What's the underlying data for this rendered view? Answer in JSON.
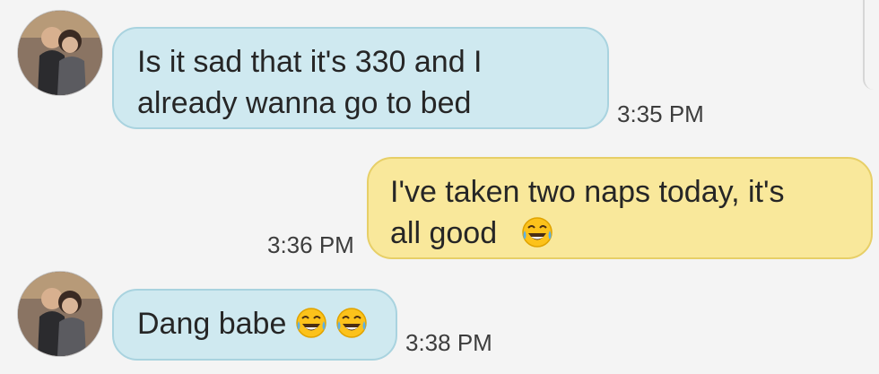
{
  "conversation": {
    "messages": [
      {
        "direction": "incoming",
        "text": "Is it sad that it's 330 and I\nalready wanna go to bed",
        "time": "3:35 PM",
        "emojis": []
      },
      {
        "direction": "outgoing",
        "text": "I've taken two naps today, it's\nall good",
        "time": "3:36 PM",
        "emojis": [
          "face-with-tears-of-joy-icon"
        ]
      },
      {
        "direction": "incoming",
        "text": "Dang babe",
        "time": "3:38 PM",
        "emojis": [
          "face-with-tears-of-joy-icon",
          "face-with-tears-of-joy-icon"
        ]
      }
    ]
  },
  "colors": {
    "incoming_bubble": "#cfe9f0",
    "outgoing_bubble": "#f9e89b",
    "background": "#f4f4f4"
  }
}
